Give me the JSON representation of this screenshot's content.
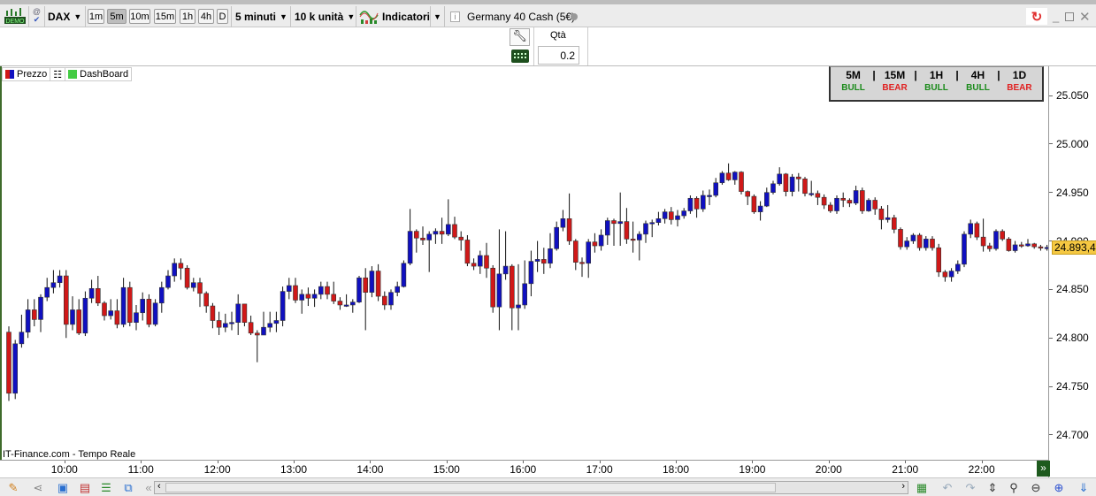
{
  "toolbar": {
    "demo_badge": "DEMO",
    "symbol": "DAX",
    "timeframes": [
      "1m",
      "5m",
      "10m",
      "15m",
      "1h",
      "4h",
      "D"
    ],
    "active_timeframe": "5m",
    "interval_select": "5 minuti",
    "units_select": "10 k unità",
    "indicators_label": "Indicatori",
    "instrument_name": "Germany 40 Cash (5€)"
  },
  "order_panel": {
    "qty_label": "Qtà",
    "qty_value": "0.2"
  },
  "legend": {
    "price_label": "Prezzo",
    "dashboard_label": "DashBoard"
  },
  "dashboard": {
    "columns": [
      {
        "tf": "5M",
        "signal": "BULL"
      },
      {
        "tf": "15M",
        "signal": "BEAR"
      },
      {
        "tf": "1H",
        "signal": "BULL"
      },
      {
        "tf": "4H",
        "signal": "BULL"
      },
      {
        "tf": "1D",
        "signal": "BEAR"
      }
    ],
    "separator": "|",
    "colors": {
      "BULL": "#1a8a1a",
      "BEAR": "#e02020"
    }
  },
  "source_label": "IT-Finance.com - Tempo Reale",
  "colors": {
    "up": "#1010c0",
    "down": "#d01818",
    "current_price_bg": "#f5c842"
  },
  "chart_data": {
    "type": "candlestick",
    "interval": "5 minuti",
    "ylim": [
      24690,
      25075
    ],
    "grid": false,
    "y_ticks": [
      "25.050",
      "25.000",
      "24.950",
      "24.900",
      "24.850",
      "24.800",
      "24.750",
      "24.700"
    ],
    "y_tick_values": [
      25050,
      25000,
      24950,
      24900,
      24850,
      24800,
      24750,
      24700
    ],
    "x_ticks": [
      "10:00",
      "11:00",
      "12:00",
      "13:00",
      "14:00",
      "15:00",
      "16:00",
      "17:00",
      "18:00",
      "19:00",
      "20:00",
      "21:00",
      "22:00"
    ],
    "current_price": 24893.4,
    "current_price_label": "24.893,4",
    "open": [
      24806,
      24743,
      24794,
      24806,
      24829,
      24819,
      24842,
      24852,
      24857,
      24864,
      24814,
      24829,
      24805,
      24841,
      24851,
      24836,
      24823,
      24828,
      24814,
      24852,
      24816,
      24826,
      24840,
      24814,
      24836,
      24852,
      24864,
      24877,
      24872,
      24852,
      24857,
      24846,
      24833,
      24818,
      24811,
      24815,
      24816,
      24835,
      24816,
      24805,
      24803,
      24811,
      24815,
      24818,
      24848,
      24854,
      24839,
      24845,
      24841,
      24845,
      24853,
      24845,
      24838,
      24834,
      24834,
      24837,
      24862,
      24847,
      24869,
      24843,
      24834,
      24847,
      24853,
      24877,
      24910,
      24903,
      24901,
      24907,
      24910,
      24907,
      24917,
      24904,
      24901,
      24877,
      24874,
      24885,
      24872,
      24832,
      24866,
      24874,
      24831,
      24834,
      24856,
      24879,
      24881,
      24877,
      24892,
      24914,
      24923,
      24900,
      24878,
      24877,
      24899,
      24895,
      24906,
      24921,
      24918,
      24920,
      24902,
      24901,
      24907,
      24918,
      24919,
      24923,
      24930,
      24922,
      24926,
      24931,
      24944,
      24933,
      24947,
      24947,
      24960,
      24970,
      24963,
      24971,
      24951,
      24946,
      24930,
      24936,
      24950,
      24959,
      24969,
      24951,
      24966,
      24964,
      24949,
      24949,
      24945,
      24937,
      24931,
      24944,
      24942,
      24939,
      24952,
      24931,
      24942,
      24933,
      24922,
      24924,
      24912,
      24894,
      24900,
      24906,
      24893,
      24902,
      24893,
      24868,
      24863,
      24869,
      24876,
      24907,
      24918,
      24904,
      24895,
      24892,
      24910,
      24902,
      24890,
      24896,
      24895,
      24897,
      24894,
      24893
    ],
    "high": [
      24812,
      24798,
      24824,
      24840,
      24840,
      24845,
      24862,
      24870,
      24870,
      24870,
      24843,
      24840,
      24848,
      24860,
      24864,
      24838,
      24840,
      24840,
      24862,
      24858,
      24834,
      24847,
      24845,
      24840,
      24858,
      24870,
      24882,
      24882,
      24875,
      24862,
      24862,
      24848,
      24836,
      24827,
      24825,
      24827,
      24845,
      24835,
      24823,
      24808,
      24827,
      24827,
      24827,
      24853,
      24862,
      24862,
      24850,
      24852,
      24850,
      24858,
      24858,
      24858,
      24842,
      24845,
      24840,
      24864,
      24872,
      24874,
      24876,
      24848,
      24850,
      24858,
      24880,
      24933,
      24912,
      24915,
      24910,
      24913,
      24924,
      24943,
      24925,
      24910,
      24906,
      24882,
      24890,
      24898,
      24875,
      24912,
      24910,
      24876,
      24876,
      24880,
      24890,
      24900,
      24893,
      24908,
      24920,
      24932,
      24949,
      24902,
      24883,
      24902,
      24908,
      24912,
      24924,
      24923,
      24950,
      24934,
      24920,
      24910,
      24921,
      24922,
      24930,
      24933,
      24935,
      24932,
      24934,
      24947,
      24946,
      24952,
      24953,
      24965,
      24972,
      24980,
      24972,
      24972,
      24952,
      24948,
      24941,
      24955,
      24962,
      24976,
      24970,
      24969,
      24970,
      24966,
      24962,
      24952,
      24948,
      24940,
      24947,
      24950,
      24944,
      24957,
      24955,
      24944,
      24945,
      24936,
      24937,
      24927,
      24914,
      24904,
      24908,
      24908,
      24905,
      24905,
      24897,
      24870,
      24872,
      24880,
      24910,
      24922,
      24920,
      24923,
      24898,
      24912,
      24912,
      24904,
      24900,
      24899,
      24902,
      24898,
      24896,
      24896
    ],
    "low": [
      24735,
      24737,
      24790,
      24800,
      24812,
      24806,
      24838,
      24846,
      24852,
      24800,
      24808,
      24803,
      24802,
      24836,
      24833,
      24818,
      24819,
      24810,
      24811,
      24812,
      24808,
      24818,
      24811,
      24812,
      24826,
      24850,
      24858,
      24860,
      24850,
      24848,
      24832,
      24826,
      24810,
      24803,
      24806,
      24808,
      24803,
      24812,
      24803,
      24775,
      24806,
      24806,
      24806,
      24812,
      24840,
      24836,
      24825,
      24833,
      24832,
      24840,
      24840,
      24835,
      24829,
      24832,
      24826,
      24836,
      24808,
      24842,
      24838,
      24829,
      24829,
      24843,
      24852,
      24875,
      24888,
      24896,
      24868,
      24897,
      24897,
      24905,
      24902,
      24890,
      24874,
      24870,
      24866,
      24862,
      24826,
      24808,
      24860,
      24808,
      24808,
      24830,
      24843,
      24868,
      24866,
      24872,
      24890,
      24910,
      24896,
      24870,
      24863,
      24862,
      24888,
      24890,
      24896,
      24895,
      24895,
      24897,
      24888,
      24880,
      24898,
      24904,
      24916,
      24918,
      24917,
      24915,
      24923,
      24928,
      24924,
      24930,
      24937,
      24945,
      24958,
      24962,
      24958,
      24948,
      24937,
      24928,
      24921,
      24935,
      24948,
      24957,
      24946,
      24946,
      24951,
      24946,
      24946,
      24937,
      24933,
      24929,
      24928,
      24935,
      24935,
      24937,
      24928,
      24930,
      24927,
      24912,
      24919,
      24908,
      24891,
      24891,
      24897,
      24890,
      24890,
      24890,
      24863,
      24858,
      24858,
      24866,
      24873,
      24903,
      24901,
      24889,
      24889,
      24890,
      24900,
      24889,
      24888,
      24893,
      24894,
      24892,
      24890,
      24890
    ],
    "close": [
      24743,
      24794,
      24806,
      24829,
      24819,
      24842,
      24852,
      24857,
      24864,
      24814,
      24829,
      24805,
      24841,
      24851,
      24836,
      24823,
      24828,
      24814,
      24852,
      24816,
      24826,
      24840,
      24814,
      24836,
      24852,
      24864,
      24877,
      24872,
      24852,
      24857,
      24846,
      24833,
      24818,
      24811,
      24815,
      24816,
      24835,
      24816,
      24805,
      24803,
      24811,
      24815,
      24818,
      24848,
      24854,
      24839,
      24845,
      24841,
      24845,
      24853,
      24845,
      24838,
      24834,
      24834,
      24837,
      24862,
      24847,
      24869,
      24843,
      24834,
      24847,
      24853,
      24877,
      24910,
      24903,
      24901,
      24907,
      24910,
      24907,
      24917,
      24904,
      24901,
      24877,
      24874,
      24885,
      24872,
      24832,
      24866,
      24874,
      24831,
      24834,
      24856,
      24879,
      24881,
      24877,
      24892,
      24914,
      24923,
      24900,
      24878,
      24877,
      24899,
      24895,
      24906,
      24921,
      24918,
      24920,
      24902,
      24901,
      24907,
      24918,
      24919,
      24923,
      24930,
      24922,
      24926,
      24931,
      24944,
      24933,
      24947,
      24947,
      24960,
      24970,
      24963,
      24971,
      24951,
      24946,
      24930,
      24936,
      24950,
      24959,
      24969,
      24951,
      24966,
      24964,
      24949,
      24949,
      24945,
      24937,
      24931,
      24944,
      24942,
      24939,
      24952,
      24931,
      24942,
      24933,
      24922,
      24924,
      24912,
      24894,
      24900,
      24906,
      24893,
      24902,
      24893,
      24868,
      24863,
      24869,
      24876,
      24907,
      24918,
      24904,
      24895,
      24892,
      24910,
      24902,
      24890,
      24896,
      24895,
      24897,
      24894,
      24893,
      24893.4
    ]
  }
}
